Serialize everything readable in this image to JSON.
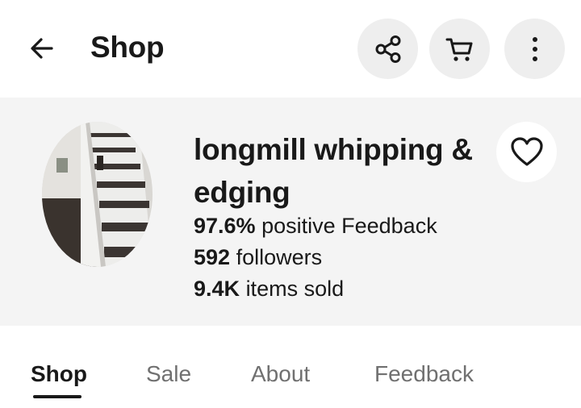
{
  "header": {
    "title": "Shop",
    "back_icon": "arrow-left-icon",
    "share_icon": "share-icon",
    "cart_icon": "cart-icon",
    "more_icon": "more-vertical-icon"
  },
  "profile": {
    "avatar_icon": "staircase-photo",
    "name": "longmill whipping & edging",
    "feedback_value": "97.6%",
    "feedback_label": "positive Feedback",
    "followers_value": "592",
    "followers_label": "followers",
    "sold_value": "9.4K",
    "sold_label": "items sold",
    "follow_icon": "heart-icon"
  },
  "tabs": [
    {
      "label": "Shop",
      "active": true
    },
    {
      "label": "Sale",
      "active": false
    },
    {
      "label": "About",
      "active": false
    },
    {
      "label": "Feedback",
      "active": false
    }
  ],
  "colors": {
    "text": "#191919",
    "muted_text": "#707070",
    "button_bg": "#eeeeee",
    "profile_bg": "#f4f4f4"
  }
}
